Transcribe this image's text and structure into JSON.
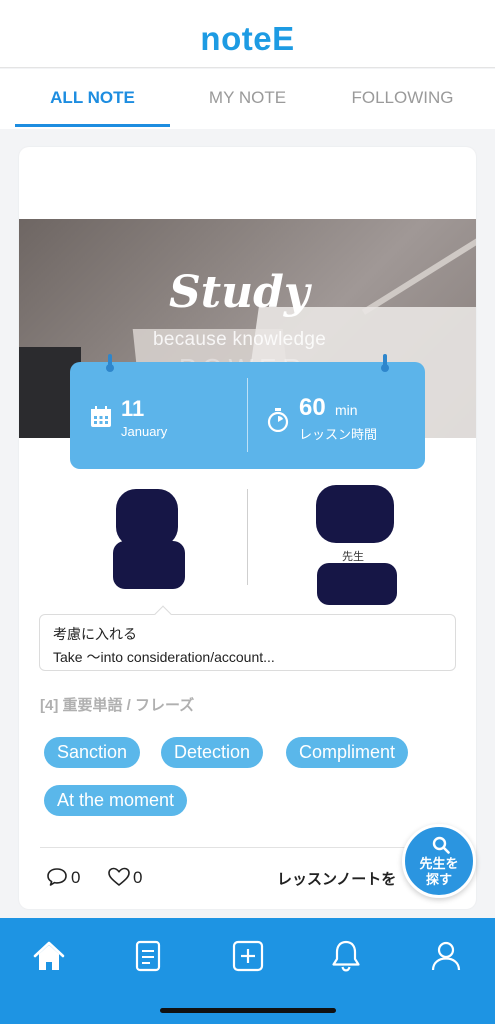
{
  "app": {
    "logo": "noteE"
  },
  "tabs": [
    {
      "label": "ALL NOTE",
      "active": true
    },
    {
      "label": "MY NOTE",
      "active": false
    },
    {
      "label": "FOLLOWING",
      "active": false
    }
  ],
  "card": {
    "image": {
      "title": "Study",
      "subtitle": "because knowledge",
      "power": "POWER"
    },
    "banner": {
      "date_day": "11",
      "date_month": "January",
      "duration": "60",
      "duration_unit": "min",
      "duration_label": "レッスン時間"
    },
    "teacher_tag": "先生",
    "phrase": {
      "japanese": "考慮に入れる",
      "english": "Take 〜into consideration/account..."
    },
    "section_label": "[4] 重要単語 / フレーズ",
    "chips": [
      "Sanction",
      "Detection",
      "Compliment",
      "At the moment"
    ],
    "comment_count": "0",
    "like_count": "0",
    "lesson_note_link": "レッスンノートを"
  },
  "fab": {
    "label_line1": "先生を",
    "label_line2": "探す",
    "icon": "search-icon"
  },
  "bottom_nav": [
    {
      "icon": "home-icon",
      "active": true
    },
    {
      "icon": "note-icon",
      "active": false
    },
    {
      "icon": "add-icon",
      "active": false
    },
    {
      "icon": "bell-icon",
      "active": false
    },
    {
      "icon": "profile-icon",
      "active": false
    }
  ],
  "colors": {
    "brand": "#1d9be3",
    "tab_active": "#1d8de0",
    "banner": "#5cb4ea",
    "chip": "#5ab7ea",
    "nav_bar": "#1e94e3"
  }
}
